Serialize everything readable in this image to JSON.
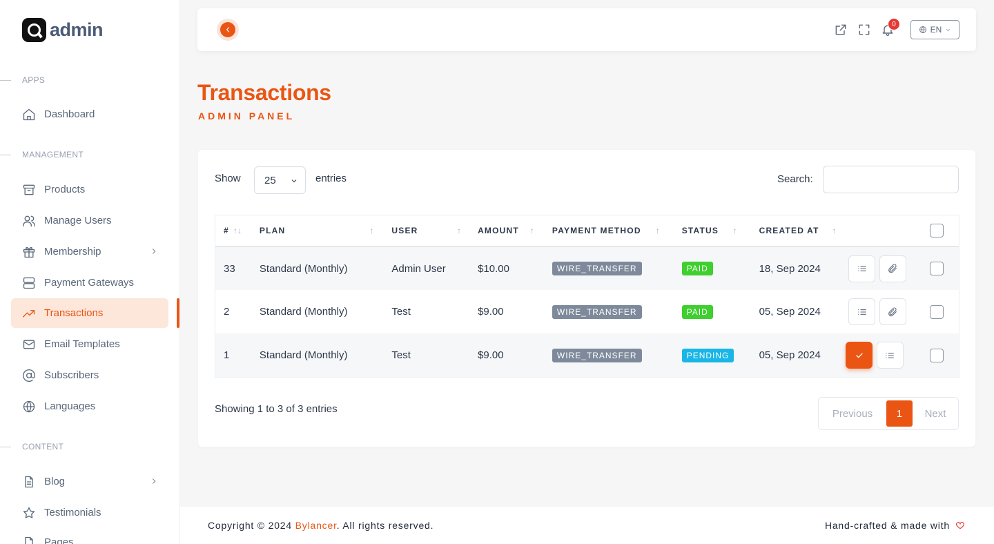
{
  "brand": {
    "name": "admin",
    "logo_icon": "q-logo-icon"
  },
  "sidebar": {
    "sections": [
      {
        "label": "APPS"
      },
      {
        "label": "MANAGEMENT"
      },
      {
        "label": "CONTENT"
      }
    ],
    "items": [
      {
        "label": "Dashboard",
        "icon": "home-icon"
      },
      {
        "label": "Products",
        "icon": "archive-box-icon"
      },
      {
        "label": "Manage Users",
        "icon": "users-icon"
      },
      {
        "label": "Membership",
        "icon": "gift-icon",
        "has_submenu": true
      },
      {
        "label": "Payment Gateways",
        "icon": "server-icon"
      },
      {
        "label": "Transactions",
        "icon": "trending-up-icon",
        "active": true
      },
      {
        "label": "Email Templates",
        "icon": "mail-icon"
      },
      {
        "label": "Subscribers",
        "icon": "at-sign-icon"
      },
      {
        "label": "Languages",
        "icon": "globe-icon"
      },
      {
        "label": "Blog",
        "icon": "file-text-icon",
        "has_submenu": true
      },
      {
        "label": "Testimonials",
        "icon": "star-icon"
      },
      {
        "label": "Pages",
        "icon": "page-icon"
      }
    ]
  },
  "topbar": {
    "notifications_count": "0",
    "language": "EN"
  },
  "page": {
    "title": "Transactions",
    "subtitle": "ADMIN PANEL"
  },
  "table_controls": {
    "show_label": "Show",
    "entries_value": "25",
    "entries_label": "entries",
    "search_label": "Search:",
    "search_value": ""
  },
  "table": {
    "columns": [
      "#",
      "PLAN",
      "USER",
      "AMOUNT",
      "PAYMENT METHOD",
      "STATUS",
      "CREATED AT"
    ],
    "rows": [
      {
        "id": "33",
        "plan": "Standard (Monthly)",
        "user": "Admin User",
        "amount": "$10.00",
        "method": "WIRE_TRANSFER",
        "status": "PAID",
        "created": "18, Sep 2024"
      },
      {
        "id": "2",
        "plan": "Standard (Monthly)",
        "user": "Test",
        "amount": "$9.00",
        "method": "WIRE_TRANSFER",
        "status": "PAID",
        "created": "05, Sep 2024"
      },
      {
        "id": "1",
        "plan": "Standard (Monthly)",
        "user": "Test",
        "amount": "$9.00",
        "method": "WIRE_TRANSFER",
        "status": "PENDING",
        "created": "05, Sep 2024"
      }
    ]
  },
  "pagination": {
    "info": "Showing 1 to 3 of 3 entries",
    "previous": "Previous",
    "current": "1",
    "next": "Next"
  },
  "footer": {
    "copyright_prefix": "Copyright © 2024 ",
    "brand": "Bylancer",
    "copyright_suffix": ". All rights reserved.",
    "handcrafted": "Hand-crafted & made with"
  },
  "colors": {
    "accent": "#ea5514",
    "paid": "#3fcf2f",
    "pending": "#19b6e6",
    "method_badge": "#7e8a9b"
  }
}
